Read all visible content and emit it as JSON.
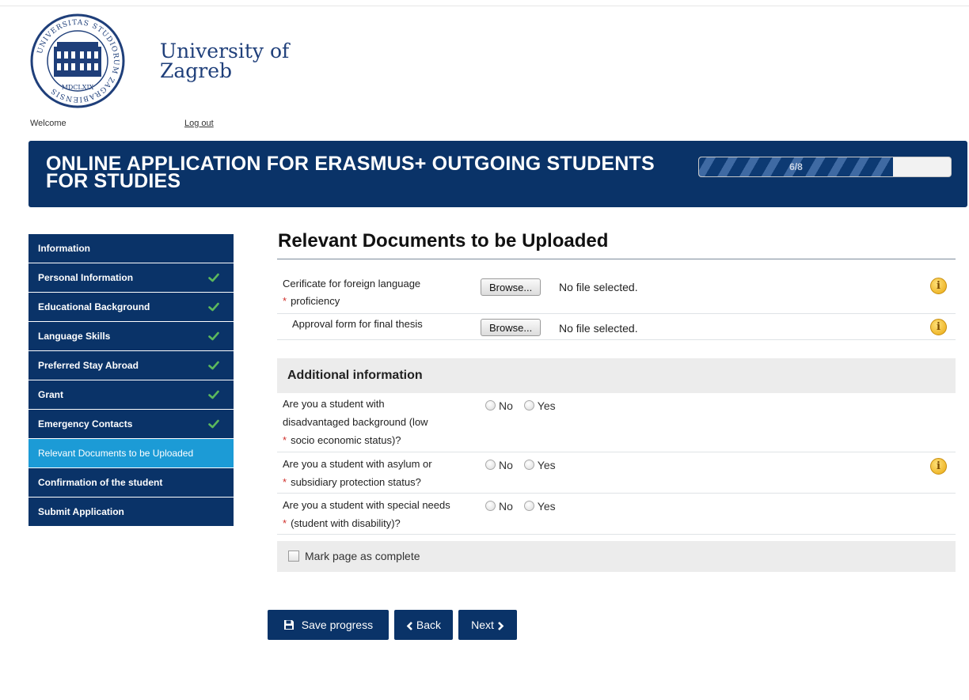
{
  "header": {
    "university_line1": "University of",
    "university_line2": "Zagreb",
    "seal_text_top": "UNIVERSITAS STUDIORUM ZAGRABIENSIS",
    "seal_year": "MDCLXIX",
    "welcome": "Welcome",
    "logout": "Log out"
  },
  "banner": {
    "title": "ONLINE APPLICATION FOR ERASMUS+ OUTGOING STUDENTS FOR STUDIES",
    "progress_text": "6/8",
    "progress_fraction": 0.77
  },
  "sidebar": {
    "items": [
      {
        "label": "Information",
        "done": false,
        "active": false
      },
      {
        "label": "Personal Information",
        "done": true,
        "active": false
      },
      {
        "label": "Educational Background",
        "done": true,
        "active": false
      },
      {
        "label": "Language Skills",
        "done": true,
        "active": false
      },
      {
        "label": "Preferred Stay Abroad",
        "done": true,
        "active": false
      },
      {
        "label": "Grant",
        "done": true,
        "active": false
      },
      {
        "label": "Emergency Contacts",
        "done": true,
        "active": false
      },
      {
        "label": "Relevant Documents to be Uploaded",
        "done": false,
        "active": true
      },
      {
        "label": "Confirmation of the student",
        "done": false,
        "active": false
      },
      {
        "label": "Submit Application",
        "done": false,
        "active": false
      }
    ]
  },
  "main": {
    "title": "Relevant Documents to be Uploaded",
    "uploads": [
      {
        "label_line1": "Cerificate for foreign language",
        "label_line2": "proficiency",
        "required": "*",
        "browse": "Browse...",
        "status": "No file selected."
      },
      {
        "label": "Approval form for final thesis",
        "browse": "Browse...",
        "status": "No file selected."
      }
    ],
    "additional_heading": "Additional information",
    "questions": [
      {
        "lines": [
          "Are you a student with",
          "disadvantaged background (low",
          "socio economic status)?"
        ],
        "required": "*",
        "no": "No",
        "yes": "Yes"
      },
      {
        "lines": [
          "Are you a student with asylum or",
          "subsidiary protection status?"
        ],
        "required": "*",
        "no": "No",
        "yes": "Yes"
      },
      {
        "lines": [
          "Are you a student with special needs",
          "(student with disability)?"
        ],
        "required": "*",
        "no": "No",
        "yes": "Yes"
      }
    ],
    "mark_complete": "Mark page as complete",
    "info_glyph": "i"
  },
  "buttons": {
    "save": "Save progress",
    "back": "Back",
    "next": "Next"
  },
  "colors": {
    "navy": "#0a3368",
    "active_blue": "#1c9bd6",
    "check_green": "#5cb85c",
    "required_red": "#d0312d",
    "info_yellow": "#e9a80f"
  },
  "icons": {
    "seal": "university-seal-icon",
    "check": "checkmark-icon",
    "info": "info-icon",
    "save": "floppy-disk-icon",
    "back": "chevron-left-icon",
    "next": "chevron-right-icon"
  }
}
